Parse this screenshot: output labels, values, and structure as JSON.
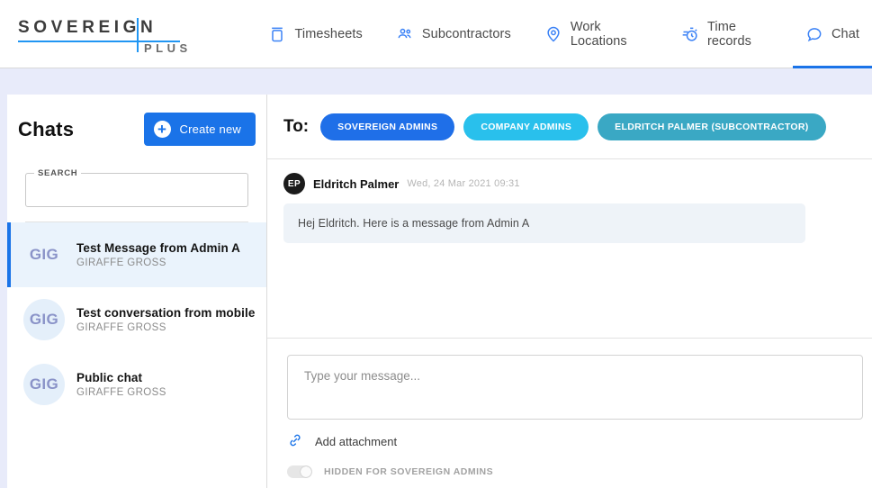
{
  "brand": {
    "word": "SOVEREIGN",
    "plus": "PLUS"
  },
  "nav": {
    "items": [
      {
        "label": "Timesheets",
        "icon": "timesheets-icon",
        "active": false
      },
      {
        "label": "Subcontractors",
        "icon": "subcontractors-icon",
        "active": false
      },
      {
        "label": "Work Locations",
        "icon": "location-pin-icon",
        "active": false
      },
      {
        "label": "Time records",
        "icon": "stopwatch-icon",
        "active": false
      },
      {
        "label": "Chat",
        "icon": "chat-bubble-icon",
        "active": true
      }
    ]
  },
  "sidebar": {
    "title": "Chats",
    "create_label": "Create new",
    "search": {
      "legend": "SEARCH",
      "value": "",
      "placeholder": ""
    },
    "chats": [
      {
        "avatar": "GIG",
        "name": "Test Message from Admin A",
        "subtitle": "GIRAFFE GROSS",
        "selected": true
      },
      {
        "avatar": "GIG",
        "name": "Test conversation from mobile",
        "subtitle": "GIRAFFE GROSS",
        "selected": false
      },
      {
        "avatar": "GIG",
        "name": "Public chat",
        "subtitle": "GIRAFFE GROSS",
        "selected": false
      }
    ]
  },
  "conversation": {
    "to_label": "To:",
    "recipients": [
      {
        "label": "SOVEREIGN ADMINS",
        "color": "#1f6fe8"
      },
      {
        "label": "COMPANY ADMINS",
        "color": "#29c0ec"
      },
      {
        "label": "ELDRITCH PALMER (SUBCONTRACTOR)",
        "color": "#3aa8c4"
      }
    ],
    "messages": [
      {
        "avatar": "EP",
        "author": "Eldritch Palmer",
        "timestamp": "Wed, 24 Mar 2021 09:31",
        "text": "Hej Eldritch. Here is a message from Admin A"
      }
    ]
  },
  "composer": {
    "placeholder": "Type your message...",
    "value": "",
    "attachment_label": "Add attachment",
    "attachment_icon": "link-icon",
    "hidden_toggle_label": "HIDDEN FOR SOVEREIGN ADMINS",
    "hidden_toggle_on": false
  },
  "colors": {
    "accent": "#1a73e8",
    "icon_blue": "#3b82f6",
    "selected_row": "#eaf3fc",
    "bubble": "#eef3f8",
    "page_band": "#e8ebfa"
  }
}
